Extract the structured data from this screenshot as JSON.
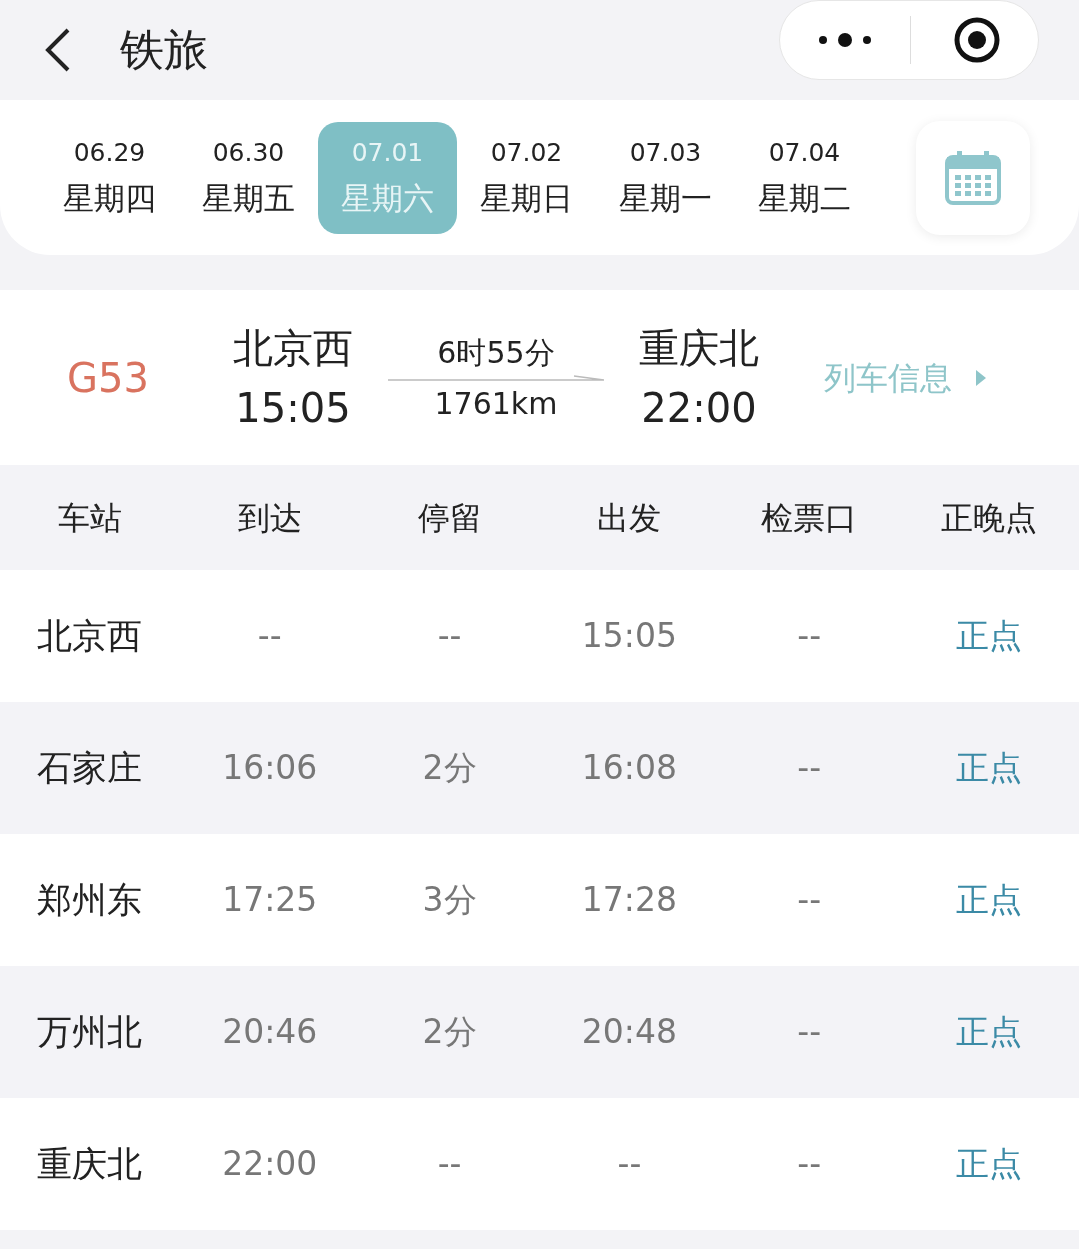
{
  "header": {
    "title": "铁旅"
  },
  "dates": [
    {
      "date": "06.29",
      "weekday": "星期四",
      "selected": false
    },
    {
      "date": "06.30",
      "weekday": "星期五",
      "selected": false
    },
    {
      "date": "07.01",
      "weekday": "星期六",
      "selected": true
    },
    {
      "date": "07.02",
      "weekday": "星期日",
      "selected": false
    },
    {
      "date": "07.03",
      "weekday": "星期一",
      "selected": false
    },
    {
      "date": "07.04",
      "weekday": "星期二",
      "selected": false
    }
  ],
  "train": {
    "number": "G53",
    "from_station": "北京西",
    "from_time": "15:05",
    "duration": "6时55分",
    "distance": "1761km",
    "to_station": "重庆北",
    "to_time": "22:00",
    "info_link": "列车信息"
  },
  "table": {
    "columns": [
      "车站",
      "到达",
      "停留",
      "出发",
      "检票口",
      "正晚点"
    ],
    "rows": [
      {
        "station": "北京西",
        "arrive": "--",
        "stop": "--",
        "depart": "15:05",
        "gate": "--",
        "status": "正点"
      },
      {
        "station": "石家庄",
        "arrive": "16:06",
        "stop": "2分",
        "depart": "16:08",
        "gate": "--",
        "status": "正点"
      },
      {
        "station": "郑州东",
        "arrive": "17:25",
        "stop": "3分",
        "depart": "17:28",
        "gate": "--",
        "status": "正点"
      },
      {
        "station": "万州北",
        "arrive": "20:46",
        "stop": "2分",
        "depart": "20:48",
        "gate": "--",
        "status": "正点"
      },
      {
        "station": "重庆北",
        "arrive": "22:00",
        "stop": "--",
        "depart": "--",
        "gate": "--",
        "status": "正点"
      }
    ]
  }
}
